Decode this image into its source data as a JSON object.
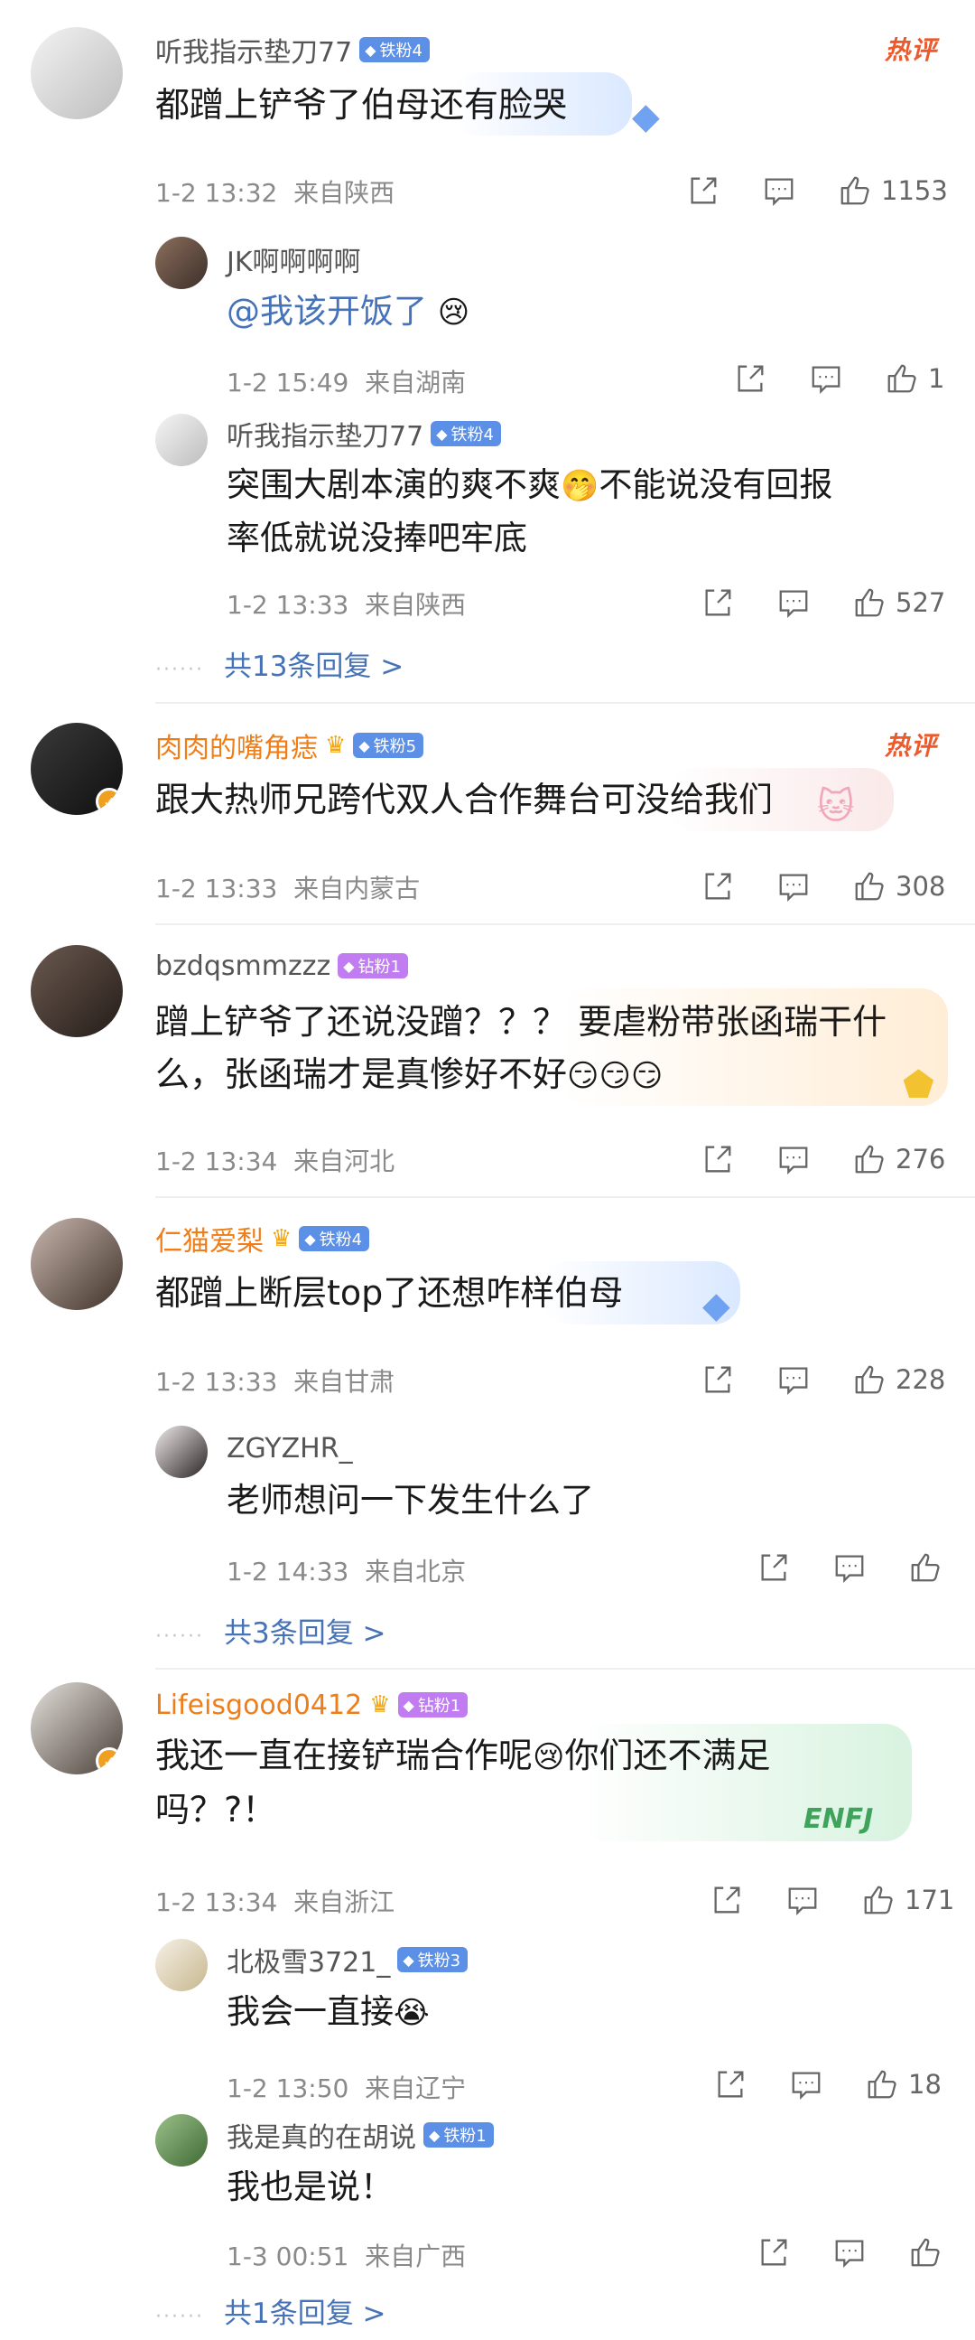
{
  "comments": [
    {
      "user": "听我指示垫刀77",
      "badge": "铁粉4",
      "hot_label": "热评",
      "text": "都蹭上铲爷了伯母还有脸哭",
      "time": "1-2 13:32",
      "location": "来自陕西",
      "likes": "1153",
      "replies": [
        {
          "user": "JK啊啊啊啊",
          "mention": "@我该开饭了",
          "emoji_name": "crying-face",
          "time": "1-2 15:49",
          "location": "来自湖南",
          "likes": "1"
        },
        {
          "user": "听我指示垫刀77",
          "badge": "铁粉4",
          "text_line1": "突围大剧本演的爽不爽",
          "text_line1b": "不能说没有回报",
          "text_line2": "率低就说没捧吧牢底",
          "emoji_name": "hand-over-mouth-face",
          "time": "1-2 13:33",
          "location": "来自陕西",
          "likes": "527"
        }
      ],
      "more_replies": "共13条回复 >"
    },
    {
      "user": "肉肉的嘴角痣",
      "badge": "铁粉5",
      "hot_label": "热评",
      "text": "跟大热师兄跨代双人合作舞台可没给我们",
      "time": "1-2 13:33",
      "location": "来自内蒙古",
      "likes": "308"
    },
    {
      "user": "bzdqsmmzzz",
      "badge": "钻粉1",
      "text_line1": "蹭上铲爷了还说没蹭？？？ 要虐粉带张函瑞干什",
      "text_line2": "么，张函瑞才是真惨好不好",
      "time": "1-2 13:34",
      "location": "来自河北",
      "likes": "276"
    },
    {
      "user": "仁猫爱梨",
      "badge": "铁粉4",
      "text": "都蹭上断层top了还想咋样伯母",
      "time": "1-2 13:33",
      "location": "来自甘肃",
      "likes": "228",
      "replies": [
        {
          "user": "ZGYZHR_",
          "text": "老师想问一下发生什么了",
          "time": "1-2 14:33",
          "location": "来自北京",
          "likes": ""
        }
      ],
      "more_replies": "共3条回复 >"
    },
    {
      "user": "Lifeisgood0412",
      "badge": "钻粉1",
      "text_line1a": "我还一直在接铲瑞合作呢",
      "text_line1b": "你们还不满足",
      "text_line2": "吗？?！",
      "time": "1-2 13:34",
      "location": "来自浙江",
      "likes": "171",
      "deco_label": "ENFJ",
      "replies": [
        {
          "user": "北极雪3721_",
          "badge": "铁粉3",
          "text": "我会一直接",
          "time": "1-2 13:50",
          "location": "来自辽宁",
          "likes": "18"
        },
        {
          "user": "我是真的在胡说",
          "badge": "铁粉1",
          "text": "我也是说！",
          "time": "1-3 00:51",
          "location": "来自广西",
          "likes": ""
        }
      ],
      "more_replies": "共1条回复 >"
    }
  ],
  "dots": "······",
  "colors": {
    "link": "#4673b8",
    "meta": "#8a8a8a",
    "name_orange": "#ef7d18",
    "hot": "#ea5a2d",
    "fan_badge": "#5c8fe6",
    "diamond_badge": "#c07cf0"
  }
}
